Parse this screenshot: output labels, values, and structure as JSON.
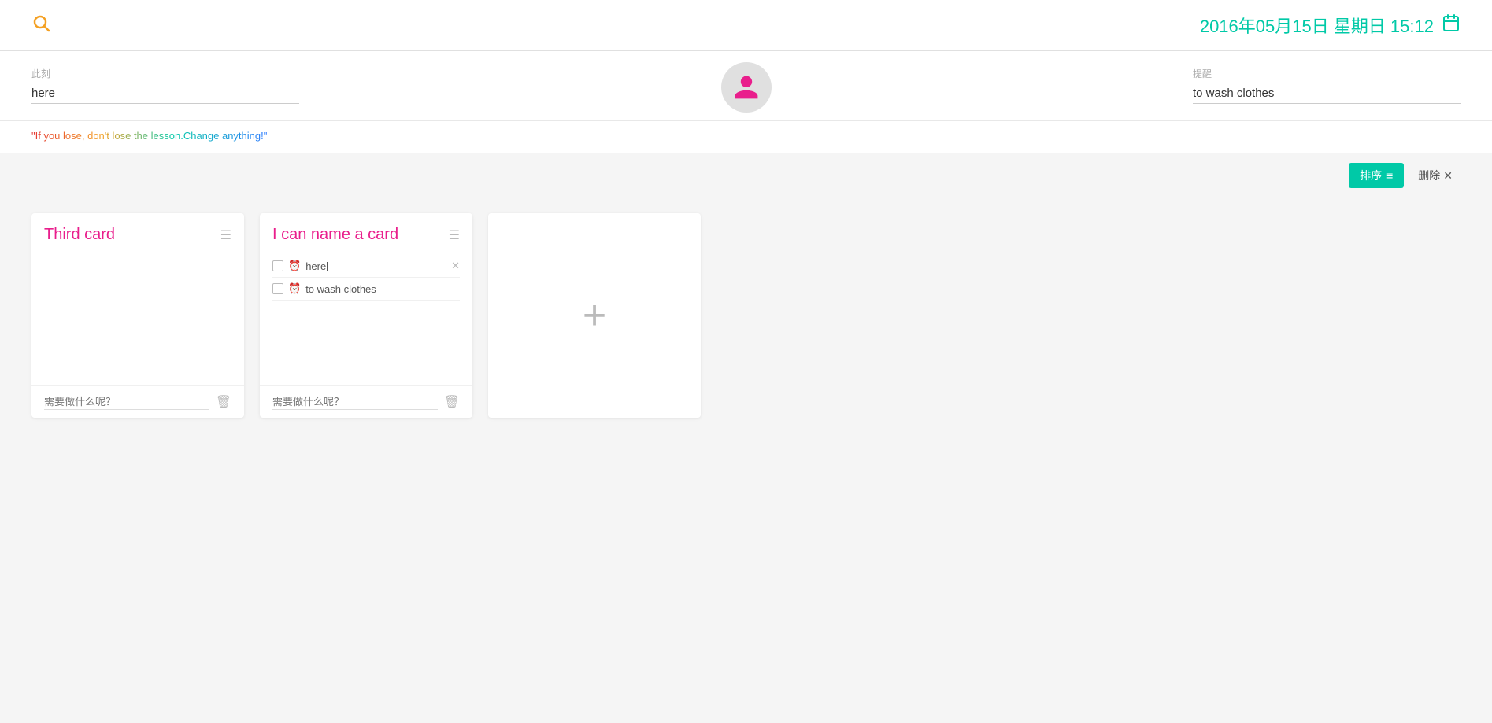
{
  "header": {
    "datetime": "2016年05月15日 星期日 15:12",
    "datetime_icon": "📅"
  },
  "mid": {
    "location_label": "此刻",
    "location_value": "here",
    "reminder_label": "提醒",
    "reminder_value": "to wash clothes",
    "location_placeholder": "",
    "reminder_placeholder": ""
  },
  "quote": {
    "text": "\"If you lose, don't lose the lesson.Change anything!\""
  },
  "toolbar": {
    "sort_label": "排序",
    "delete_label": "删除",
    "sort_icon": "≡",
    "delete_icon": "✕"
  },
  "cards": [
    {
      "id": "card-1",
      "title": "Third card",
      "tasks": [],
      "input_placeholder": "需要做什么呢？"
    },
    {
      "id": "card-2",
      "title": "I can name a card",
      "tasks": [
        {
          "text": "here",
          "has_clock": true,
          "has_delete": true
        },
        {
          "text": "to wash clothes",
          "has_clock": true,
          "has_delete": false
        }
      ],
      "input_placeholder": "需要做什么呢？"
    }
  ],
  "add_card": {
    "icon": "+"
  }
}
